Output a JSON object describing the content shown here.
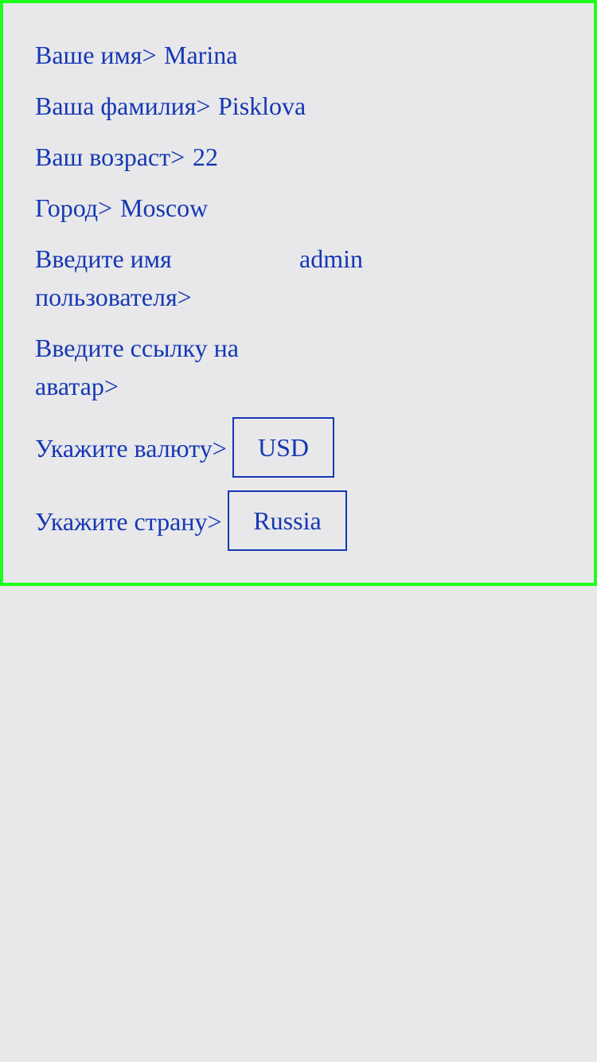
{
  "profile": {
    "name_label": "Ваше имя>",
    "name_value": "Marina",
    "surname_label": "Ваша фамилия>",
    "surname_value": "Pisklova",
    "age_label": "Ваш возраст>",
    "age_value": "22",
    "city_label": "Город>",
    "city_value": "Moscow",
    "username_label_line1": "Введите имя",
    "username_label_line2": "пользователя>",
    "username_value": "admin",
    "avatar_label_line1": "Введите ссылку на",
    "avatar_label_line2": "аватар>",
    "avatar_value": "",
    "currency_label": "Укажите валюту>",
    "currency_value": "USD",
    "country_label": "Укажите страну>",
    "country_value": "Russia"
  },
  "colors": {
    "text": "#1537b4",
    "panel_border": "#1cff1c",
    "background": "#e8e8ea"
  }
}
